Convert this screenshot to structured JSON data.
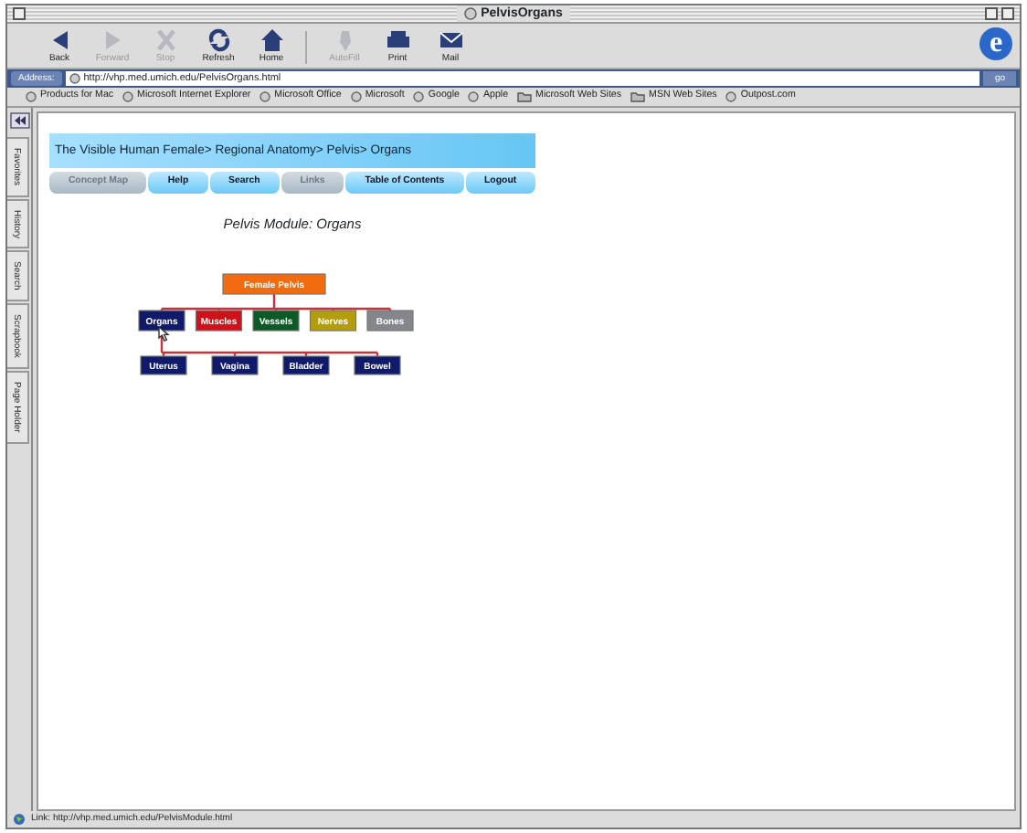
{
  "window": {
    "title": "PelvisOrgans"
  },
  "toolbar": [
    {
      "label": "Back",
      "kind": "back",
      "disabled": false
    },
    {
      "label": "Forward",
      "kind": "forward",
      "disabled": true
    },
    {
      "label": "Stop",
      "kind": "stop",
      "disabled": true
    },
    {
      "label": "Refresh",
      "kind": "refresh",
      "disabled": false
    },
    {
      "label": "Home",
      "kind": "home",
      "disabled": false
    },
    {
      "label": "AutoFill",
      "kind": "autofill",
      "disabled": true
    },
    {
      "label": "Print",
      "kind": "print",
      "disabled": false
    },
    {
      "label": "Mail",
      "kind": "mail",
      "disabled": false
    }
  ],
  "logo": "e",
  "address": {
    "label": "Address:",
    "value": "http://vhp.med.umich.edu/PelvisOrgans.html",
    "go": "go"
  },
  "favorites": [
    {
      "label": "Products for Mac",
      "kind": "page"
    },
    {
      "label": "Microsoft Internet Explorer",
      "kind": "page"
    },
    {
      "label": "Microsoft Office",
      "kind": "page"
    },
    {
      "label": "Microsoft",
      "kind": "page"
    },
    {
      "label": "Google",
      "kind": "page"
    },
    {
      "label": "Apple",
      "kind": "page"
    },
    {
      "label": "Microsoft Web Sites",
      "kind": "folder"
    },
    {
      "label": "MSN Web Sites",
      "kind": "folder"
    },
    {
      "label": "Outpost.com",
      "kind": "page"
    }
  ],
  "sidebar_tabs": [
    "Favorites",
    "History",
    "Search",
    "Scrapbook",
    "Page Holder"
  ],
  "page": {
    "breadcrumb": "The Visible Human Female> Regional Anatomy> Pelvis> Organs",
    "nav": [
      {
        "label": "Concept Map",
        "dimmed": true
      },
      {
        "label": "Help",
        "dimmed": false
      },
      {
        "label": "Search",
        "dimmed": false
      },
      {
        "label": "Links",
        "dimmed": true
      },
      {
        "label": "Table of Contents",
        "dimmed": false
      },
      {
        "label": "Logout",
        "dimmed": false
      }
    ],
    "heading": "Pelvis Module: Organs",
    "concept_map": {
      "root": {
        "label": "Female Pelvis",
        "color": "#f26b0f"
      },
      "categories": [
        {
          "label": "Organs",
          "color": "#101a6b",
          "children": [
            {
              "label": "Uterus",
              "color": "#101a6b"
            },
            {
              "label": "Vagina",
              "color": "#101a6b"
            },
            {
              "label": "Bladder",
              "color": "#101a6b"
            },
            {
              "label": "Bowel",
              "color": "#101a6b"
            }
          ]
        },
        {
          "label": "Muscles",
          "color": "#d0101a"
        },
        {
          "label": "Vessels",
          "color": "#0e5a26"
        },
        {
          "label": "Nerves",
          "color": "#b39d0c"
        },
        {
          "label": "Bones",
          "color": "#85858c"
        }
      ]
    }
  },
  "status_bar": "Link: http://vhp.med.umich.edu/PelvisModule.html"
}
